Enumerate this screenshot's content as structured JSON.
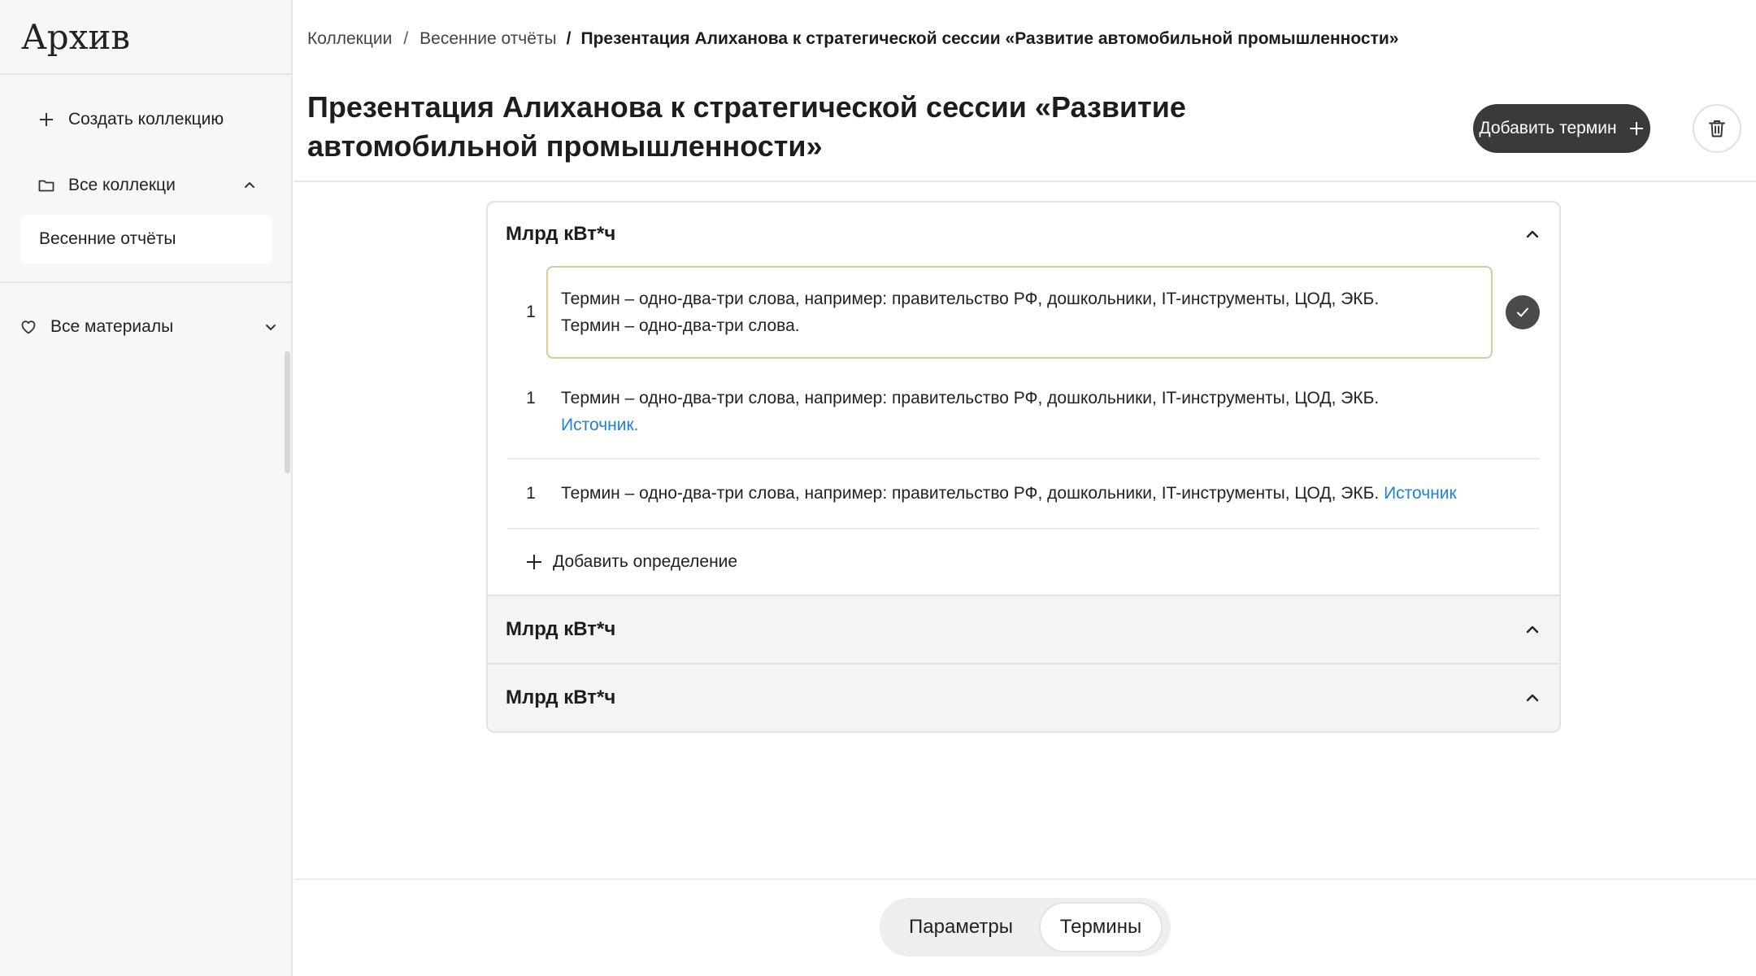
{
  "app": {
    "logo": "Архив"
  },
  "sidebar": {
    "create_label": "Создать коллекцию",
    "all_collections_label": "Все коллекци",
    "collections": [
      {
        "label": "Весенние отчёты"
      }
    ],
    "all_materials_label": "Все материалы"
  },
  "breadcrumb": {
    "items": [
      "Коллекции",
      "Весенние отчёты"
    ],
    "current": "Презентация Алиханова к стратегической сессии «Развитие автомобильной промышленности»",
    "separator": "/"
  },
  "page": {
    "title": "Презентация Алиханова к стратегической сессии «Развитие автомобильной промышленности»",
    "add_term_label": "Добавить термин"
  },
  "terms": [
    {
      "title": "Млрд кВт*ч",
      "editing": {
        "number": "1",
        "line1": "Термин – одно-два-три слова, например: правительство РФ, дошкольники, IT-инструменты, ЦОД, ЭКБ.",
        "line2": "Термин – одно-два-три слова."
      },
      "definitions": [
        {
          "number": "1",
          "text": "Термин – одно-два-три слова, например: правительство РФ, дошкольники, IT-инструменты, ЦОД, ЭКБ.",
          "source": "Источник."
        },
        {
          "number": "1",
          "text": "Термин – одно-два-три слова, например: правительство РФ, дошкольники, IT-инструменты, ЦОД, ЭКБ.",
          "source": "Источник"
        }
      ],
      "add_definition_label": "Добавить onределение"
    },
    {
      "title": "Млрд кВт*ч"
    },
    {
      "title": "Млрд кВт*ч"
    }
  ],
  "tabs": {
    "params": "Параметры",
    "terms": "Термины",
    "active": "Термины"
  },
  "colors": {
    "accent_link": "#1f82d6",
    "button_dark": "#3a3a3a",
    "editor_border": "#d9c99a"
  }
}
